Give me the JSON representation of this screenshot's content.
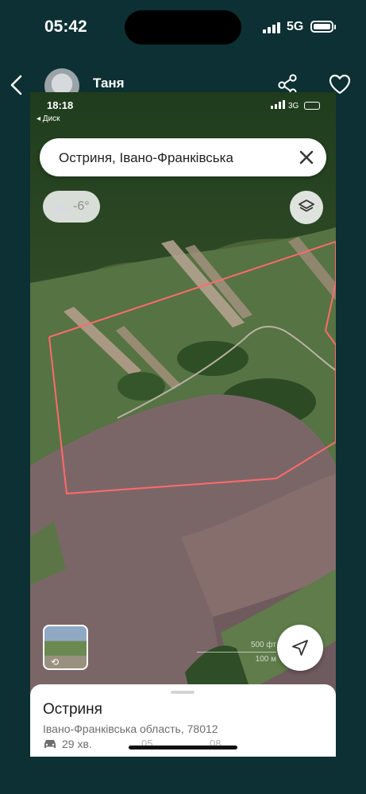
{
  "status_bar": {
    "time": "05:42",
    "network": "5G"
  },
  "chat_header": {
    "name": "Таня"
  },
  "shared_screenshot": {
    "status_bar": {
      "time": "18:18",
      "back_app": "◂ Диск",
      "network": "3G"
    },
    "search": {
      "query": "Остриня, Івано-Франківська"
    },
    "weather": {
      "temperature": "-6°"
    },
    "scale": {
      "feet": "500 фт",
      "meters": "100 м"
    },
    "place_card": {
      "name": "Остриня",
      "address": "Івано-Франківська область, 78012",
      "drive_time": "29 хв.",
      "overlay_left": "05",
      "overlay_right": "08"
    }
  },
  "colors": {
    "background": "#0c3033",
    "boundary": "#ff6a6a",
    "card": "#ffffff"
  },
  "icons": [
    "back-chevron-icon",
    "share-icon",
    "heart-icon",
    "close-icon",
    "cloud-icon",
    "layers-icon",
    "location-arrow-icon",
    "car-icon",
    "signal-icon",
    "battery-icon"
  ]
}
